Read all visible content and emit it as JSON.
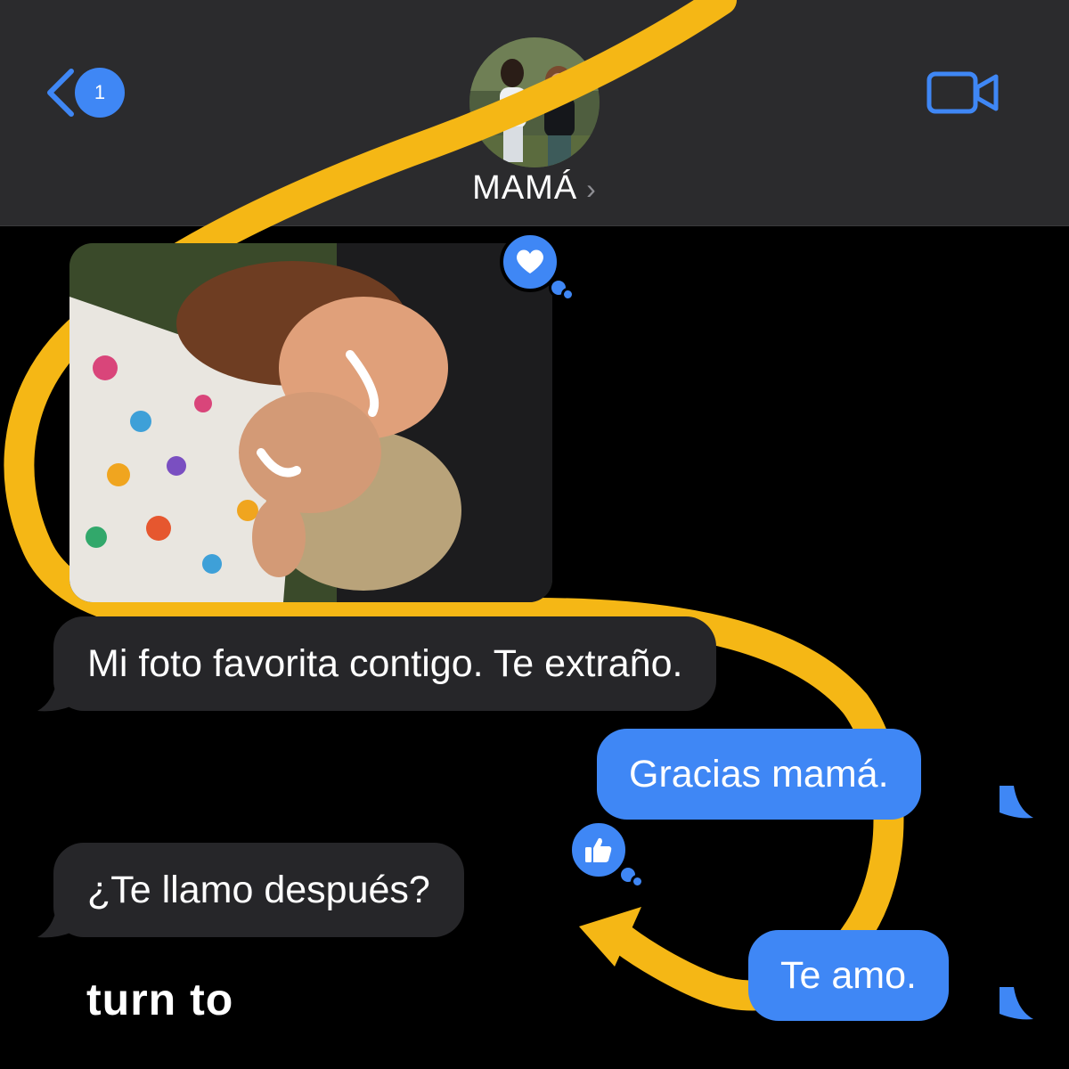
{
  "header": {
    "back_badge": "1",
    "contact_name": "MAMÁ",
    "name_chevron": "›",
    "back_icon": "chevron-left-icon",
    "video_icon": "video-camera-icon"
  },
  "messages": [
    {
      "type": "photo",
      "direction": "incoming",
      "reaction": "heart-icon"
    },
    {
      "type": "text",
      "direction": "incoming",
      "text": "Mi foto favorita contigo. Te extraño."
    },
    {
      "type": "text",
      "direction": "outgoing",
      "text": "Gracias mamá."
    },
    {
      "type": "text",
      "direction": "incoming",
      "text": "¿Te llamo después?",
      "reaction": "thumbs-up-icon"
    },
    {
      "type": "text",
      "direction": "outgoing",
      "text": "Te amo."
    }
  ],
  "brand": {
    "text": "turn to"
  },
  "colors": {
    "header_bg": "#2b2b2d",
    "incoming_bubble": "#262629",
    "outgoing_bubble": "#3f87f5",
    "ribbon": "#f5b715",
    "accent": "#3f87f5"
  }
}
